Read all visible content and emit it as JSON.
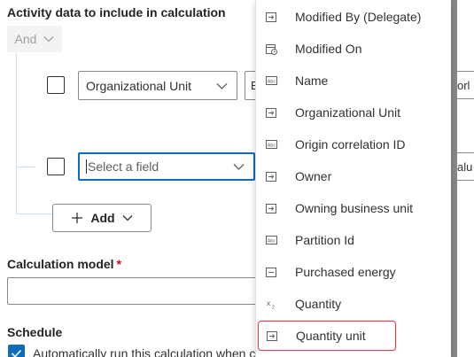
{
  "criteria": {
    "section_title": "Activity data to include in calculation",
    "operator_label": "And",
    "row1": {
      "field_value": "Organizational Unit",
      "operator_fragment": "E",
      "value_fragment": "orl"
    },
    "row2": {
      "field_placeholder": "Select a field",
      "value_fragment": "alu"
    },
    "add_label": "Add"
  },
  "calculation_model": {
    "label": "Calculation model",
    "required_marker": "*",
    "value": ""
  },
  "schedule": {
    "label": "Schedule",
    "auto_run_label": "Automatically run this calculation when c",
    "auto_run_checked": true
  },
  "dropdown": {
    "items": [
      {
        "label": "Modified By (Delegate)",
        "icon": "lookup-icon"
      },
      {
        "label": "Modified On",
        "icon": "datetime-icon"
      },
      {
        "label": "Name",
        "icon": "text-icon"
      },
      {
        "label": "Organizational Unit",
        "icon": "lookup-icon"
      },
      {
        "label": "Origin correlation ID",
        "icon": "text-icon"
      },
      {
        "label": "Owner",
        "icon": "lookup-icon"
      },
      {
        "label": "Owning business unit",
        "icon": "lookup-icon"
      },
      {
        "label": "Partition Id",
        "icon": "text-icon"
      },
      {
        "label": "Purchased energy",
        "icon": "option-set-icon"
      },
      {
        "label": "Quantity",
        "icon": "number-icon"
      },
      {
        "label": "Quantity unit",
        "icon": "lookup-icon"
      }
    ],
    "highlighted_item": "Quantity unit"
  },
  "colors": {
    "accent": "#0f6cbd",
    "highlight_border": "#d1414f",
    "required": "#c50f1f"
  }
}
